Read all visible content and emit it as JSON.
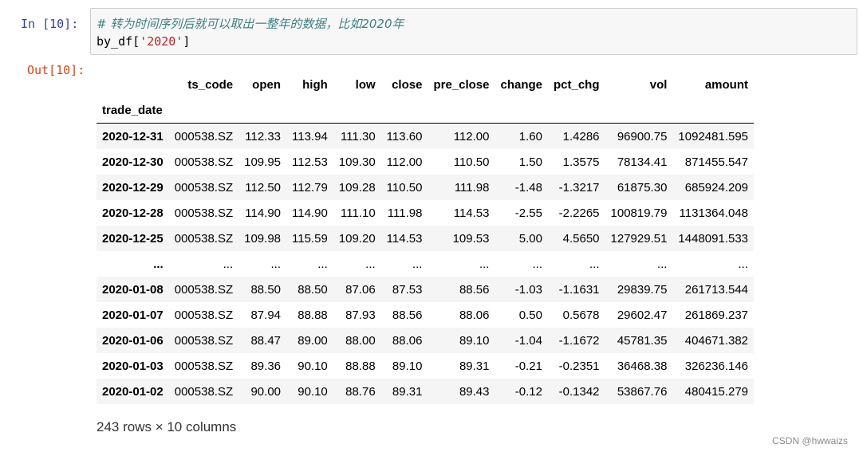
{
  "cell": {
    "in_prompt": "In  [10]:",
    "out_prompt": "Out[10]:",
    "code_comment": "# 转为时间序列后就可以取出一整年的数据，比如2020年",
    "code_prefix": "by_df[",
    "code_string": "'2020'",
    "code_suffix": "]"
  },
  "dataframe": {
    "index_name": "trade_date",
    "columns": [
      "ts_code",
      "open",
      "high",
      "low",
      "close",
      "pre_close",
      "change",
      "pct_chg",
      "vol",
      "amount"
    ],
    "rows": [
      {
        "index": "2020-12-31",
        "cells": [
          "000538.SZ",
          "112.33",
          "113.94",
          "111.30",
          "113.60",
          "112.00",
          "1.60",
          "1.4286",
          "96900.75",
          "1092481.595"
        ]
      },
      {
        "index": "2020-12-30",
        "cells": [
          "000538.SZ",
          "109.95",
          "112.53",
          "109.30",
          "112.00",
          "110.50",
          "1.50",
          "1.3575",
          "78134.41",
          "871455.547"
        ]
      },
      {
        "index": "2020-12-29",
        "cells": [
          "000538.SZ",
          "112.50",
          "112.79",
          "109.28",
          "110.50",
          "111.98",
          "-1.48",
          "-1.3217",
          "61875.30",
          "685924.209"
        ]
      },
      {
        "index": "2020-12-28",
        "cells": [
          "000538.SZ",
          "114.90",
          "114.90",
          "111.10",
          "111.98",
          "114.53",
          "-2.55",
          "-2.2265",
          "100819.79",
          "1131364.048"
        ]
      },
      {
        "index": "2020-12-25",
        "cells": [
          "000538.SZ",
          "109.98",
          "115.59",
          "109.20",
          "114.53",
          "109.53",
          "5.00",
          "4.5650",
          "127929.51",
          "1448091.533"
        ]
      },
      {
        "index": "...",
        "cells": [
          "...",
          "...",
          "...",
          "...",
          "...",
          "...",
          "...",
          "...",
          "...",
          "..."
        ]
      },
      {
        "index": "2020-01-08",
        "cells": [
          "000538.SZ",
          "88.50",
          "88.50",
          "87.06",
          "87.53",
          "88.56",
          "-1.03",
          "-1.1631",
          "29839.75",
          "261713.544"
        ]
      },
      {
        "index": "2020-01-07",
        "cells": [
          "000538.SZ",
          "87.94",
          "88.88",
          "87.93",
          "88.56",
          "88.06",
          "0.50",
          "0.5678",
          "29602.47",
          "261869.237"
        ]
      },
      {
        "index": "2020-01-06",
        "cells": [
          "000538.SZ",
          "88.47",
          "89.00",
          "88.00",
          "88.06",
          "89.10",
          "-1.04",
          "-1.1672",
          "45781.35",
          "404671.382"
        ]
      },
      {
        "index": "2020-01-03",
        "cells": [
          "000538.SZ",
          "89.36",
          "90.10",
          "88.88",
          "89.10",
          "89.31",
          "-0.21",
          "-0.2351",
          "36468.38",
          "326236.146"
        ]
      },
      {
        "index": "2020-01-02",
        "cells": [
          "000538.SZ",
          "90.00",
          "90.10",
          "88.76",
          "89.31",
          "89.43",
          "-0.12",
          "-0.1342",
          "53867.76",
          "480415.279"
        ]
      }
    ],
    "shape_text": "243 rows × 10 columns"
  },
  "watermark": "CSDN @hwwaizs"
}
